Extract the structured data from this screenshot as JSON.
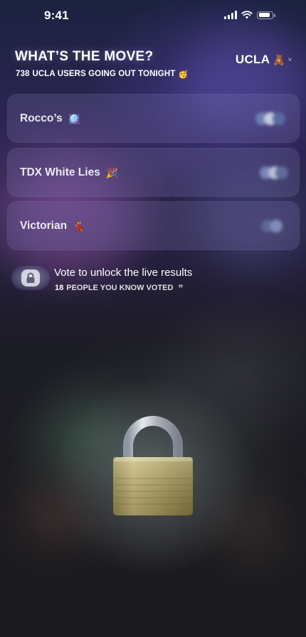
{
  "status_bar": {
    "time": "9:41"
  },
  "header": {
    "title": "WHAT’S THE MOVE?",
    "going_out_count": "738",
    "going_out_text": "UCLA USERS GOING OUT TONIGHT",
    "going_out_emoji": "🥳",
    "school": "UCLA",
    "school_emoji": "🧸",
    "school_chevron": "˅"
  },
  "options": [
    {
      "label": "Rocco’s",
      "emoji": "🪩"
    },
    {
      "label": "TDX White Lies",
      "emoji": "🎉"
    },
    {
      "label": "Victorian",
      "emoji": "💃"
    }
  ],
  "vote_prompt": {
    "title": "Vote to unlock the live results",
    "count": "18",
    "subtitle": "PEOPLE YOU KNOW VOTED",
    "quote_glyph": "”"
  },
  "colors": {
    "card_bg": "rgba(120,110,170,0.28)",
    "padlock_gold": "#b9a965",
    "padlock_shackle": "#c8ccd4"
  }
}
